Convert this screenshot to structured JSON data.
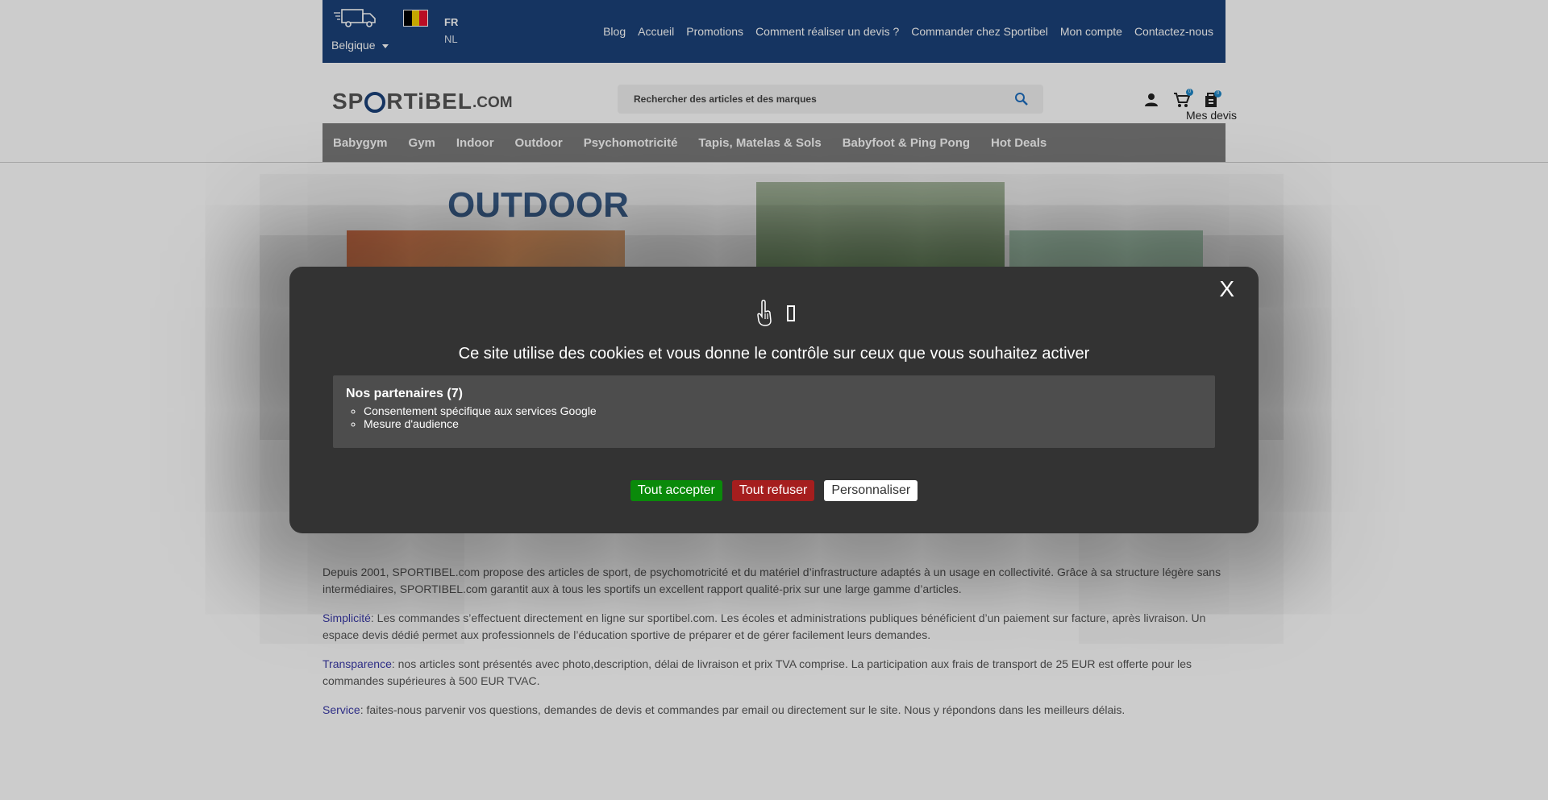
{
  "topbar": {
    "country": "Belgique",
    "languages": [
      "FR",
      "NL"
    ],
    "nav": [
      "Blog",
      "Accueil",
      "Promotions",
      "Comment réaliser un devis ?",
      "Commander chez Sportibel",
      "Mon compte",
      "Contactez-nous"
    ]
  },
  "header": {
    "logo_part1": "SP",
    "logo_part2": "RTiBEL",
    "logo_suffix": ".COM",
    "search_placeholder": "Rechercher des articles et des marques",
    "cart_count": "0",
    "quote_count": "0",
    "mes_devis": "Mes devis"
  },
  "categories": [
    "Babygym",
    "Gym",
    "Indoor",
    "Outdoor",
    "Psychomotricité",
    "Tapis, Matelas & Sols",
    "Babyfoot & Ping Pong",
    "Hot Deals"
  ],
  "hero": {
    "title": "OUTDOOR"
  },
  "intro": {
    "p1": "Depuis 2001, SPORTIBEL.com propose des articles de sport, de psychomotricité et du matériel d’infrastructure adaptés à un usage en collectivité. Grâce à sa structure légère sans intermédiaires, SPORTIBEL.com garantit aux à tous les sportifs  un excellent rapport qualité-prix sur une large gamme d’articles.",
    "p2_label": "Simplicité",
    "p2": ": Les commandes s’effectuent directement en ligne sur sportibel.com. Les écoles et administrations publiques bénéficient d’un paiement sur facture, après livraison. Un espace devis dédié permet aux professionnels de l’éducation sportive de préparer et de gérer facilement leurs demandes.",
    "p3_label": "Transparence",
    "p3": ": nos articles sont présentés avec photo,description, délai de livraison et prix TVA comprise. La participation aux frais de transport de 25 EUR est offerte pour les commandes supérieures à 500 EUR TVAC.",
    "p4_label": "Service",
    "p4": ": faites-nous parvenir vos questions, demandes de devis et commandes par email ou directement sur le site. Nous y répondons dans les meilleurs délais."
  },
  "cookie_modal": {
    "close": "X",
    "title": "Ce site utilise des cookies et vous donne le contrôle sur ceux que vous souhaitez activer",
    "partners_title": "Nos partenaires (7)",
    "partners": [
      "Consentement spécifique aux services Google",
      "Mesure d'audience"
    ],
    "accept": "Tout accepter",
    "refuse": "Tout refuser",
    "customize": "Personnaliser"
  },
  "colors": {
    "topbar": "#1b427a",
    "accept": "#0a8a0a",
    "refuse": "#a51e1e",
    "modal": "#333333"
  }
}
